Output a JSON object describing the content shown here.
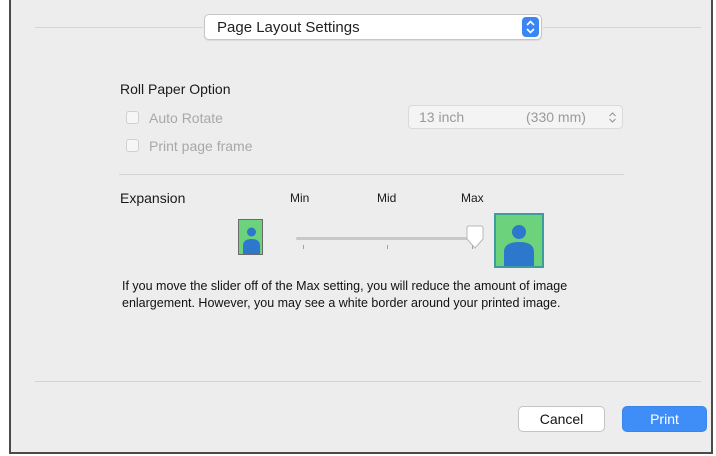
{
  "header": {
    "preset_popup_value": "Page Layout Settings",
    "stepper_icon": "up-down-chevron-icon"
  },
  "roll_paper": {
    "title": "Roll Paper Option",
    "auto_rotate_label": "Auto Rotate",
    "auto_rotate_checked": false,
    "print_page_frame_label": "Print page frame",
    "print_page_frame_checked": false,
    "roll_width": "13 inch",
    "roll_width_mm": "(330 mm)"
  },
  "expansion": {
    "title": "Expansion",
    "ticks": [
      "Min",
      "Mid",
      "Max"
    ],
    "value": "Max",
    "min_icon": "person-small-icon",
    "max_icon": "person-large-icon",
    "description": "If you move the slider off of the Max setting, you will reduce the amount of image enlargement. However, you may see a white border around your printed image."
  },
  "footer": {
    "cancel_label": "Cancel",
    "print_label": "Print"
  },
  "colors": {
    "accent": "#3f8ef7",
    "image_green": "#6cd37c",
    "image_blue": "#2d77cc"
  }
}
